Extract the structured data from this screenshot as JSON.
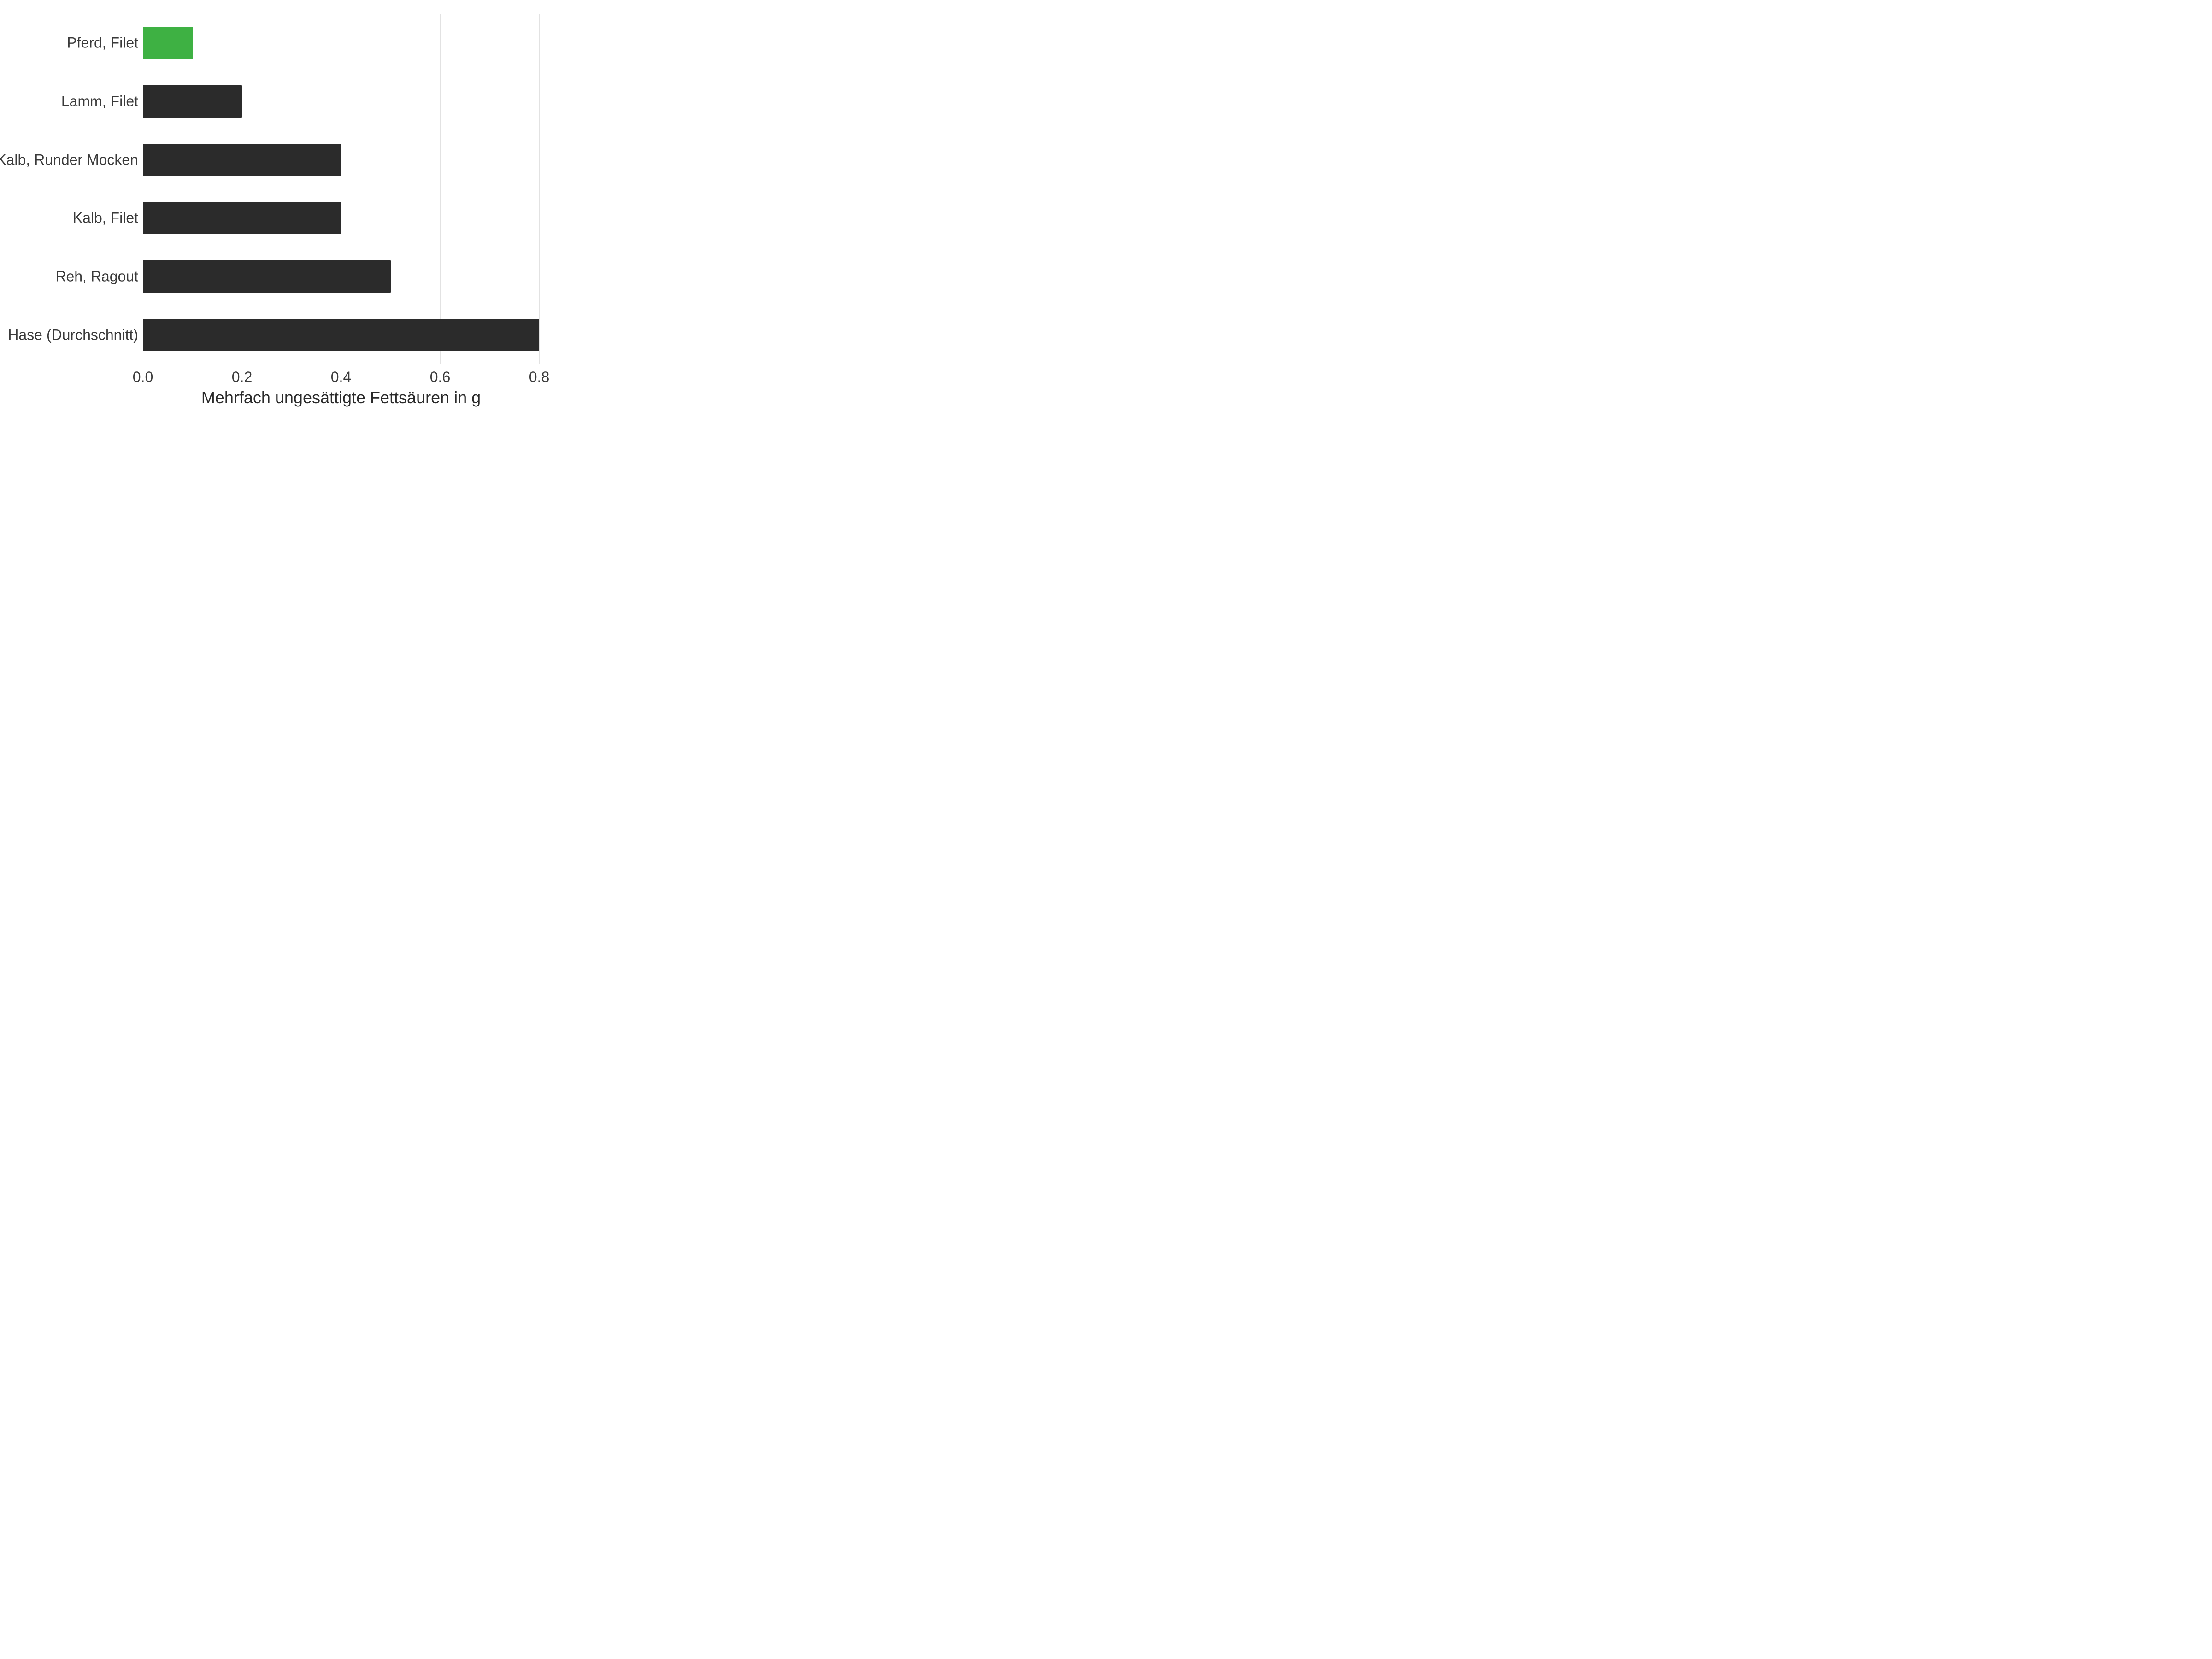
{
  "chart_data": {
    "type": "bar",
    "orientation": "horizontal",
    "categories": [
      "Pferd, Filet",
      "Lamm, Filet",
      "Kalb, Runder Mocken",
      "Kalb, Filet",
      "Reh, Ragout",
      "Hase (Durchschnitt)"
    ],
    "values": [
      0.1,
      0.2,
      0.4,
      0.4,
      0.5,
      0.8
    ],
    "highlight_index": 0,
    "xlabel": "Mehrfach ungesättigte Fettsäuren in g",
    "ylabel": "",
    "title": "",
    "xlim": [
      0.0,
      0.8
    ],
    "x_ticks": [
      0.0,
      0.2,
      0.4,
      0.6,
      0.8
    ],
    "x_tick_labels": [
      "0.0",
      "0.2",
      "0.4",
      "0.6",
      "0.8"
    ],
    "colors": {
      "default_bar": "#2b2b2b",
      "highlight_bar": "#3eb143",
      "grid": "#e2e2e2",
      "text": "#3a3a3a"
    }
  }
}
